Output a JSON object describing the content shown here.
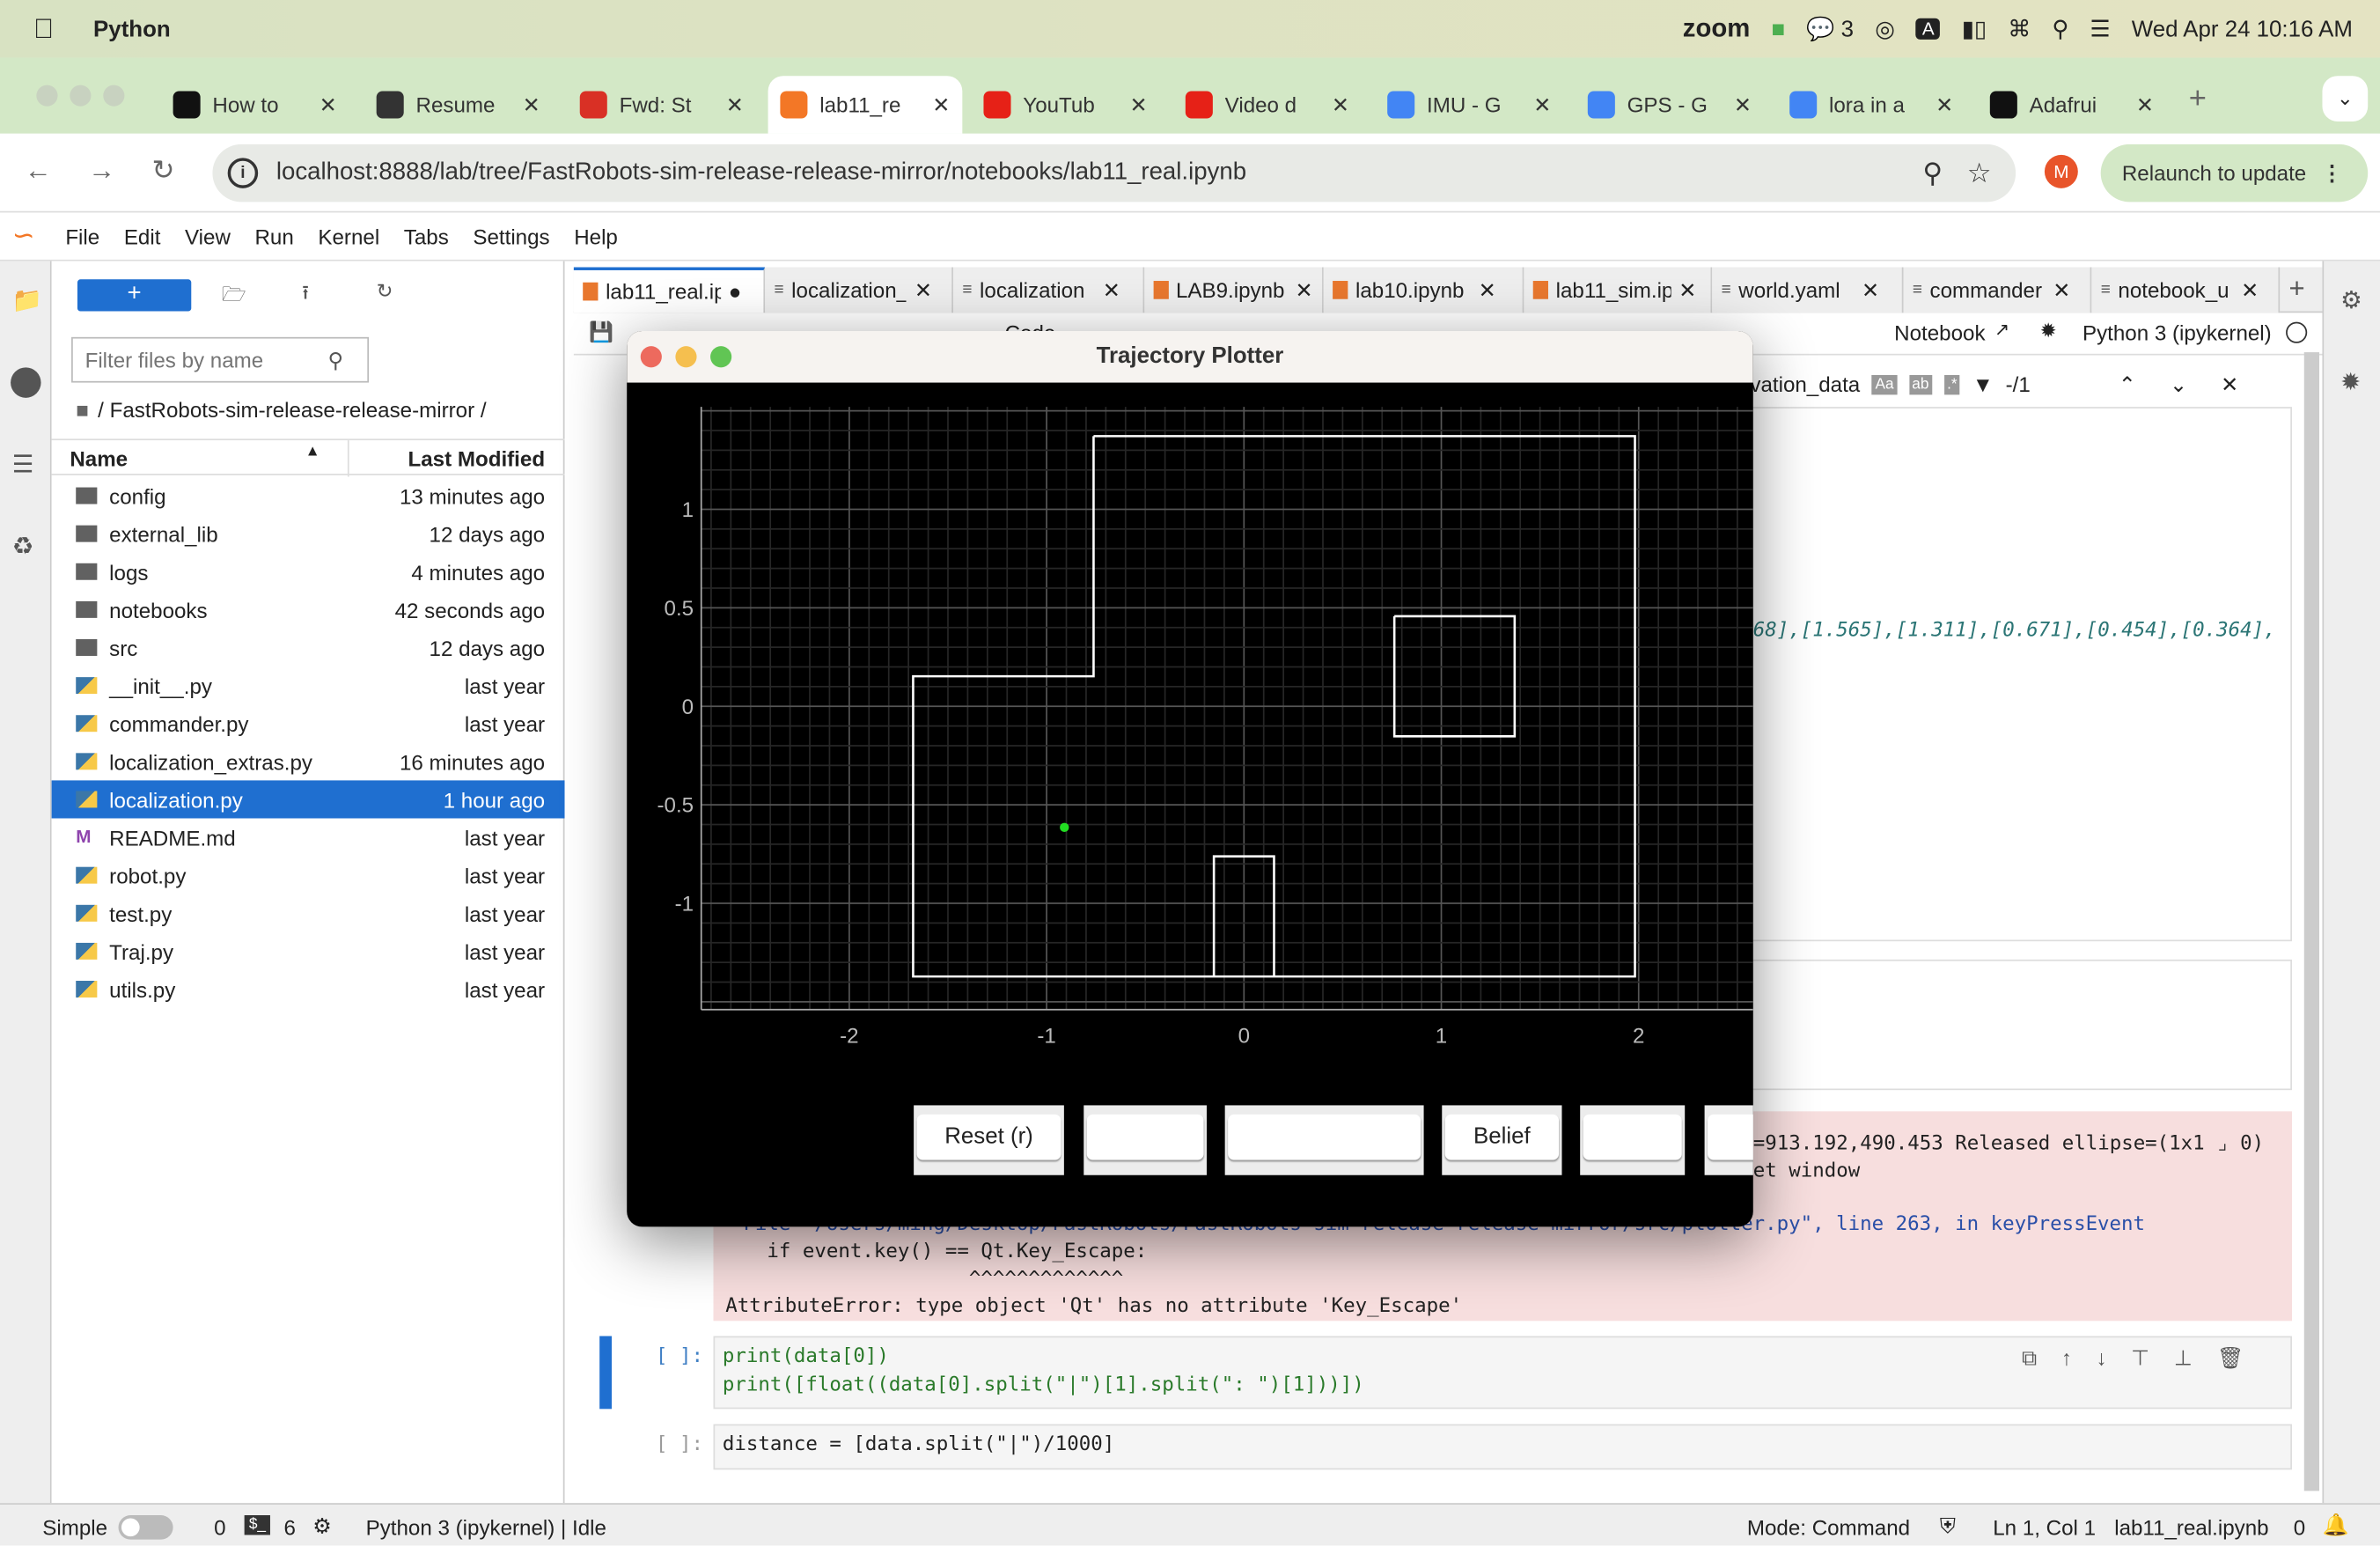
{
  "macos_menubar": {
    "app_name": "Python",
    "zoom": "zoom",
    "wechat_count": "3",
    "keyboard": "A",
    "datetime": "Wed Apr 24  10:16 AM"
  },
  "browser": {
    "tabs": [
      {
        "label": "How to",
        "icon": "bolt-icon",
        "color": "#111111"
      },
      {
        "label": "Resume",
        "icon": "globe-icon",
        "color": "#333333"
      },
      {
        "label": "Fwd: St",
        "icon": "gmail-icon",
        "color": "#d93025"
      },
      {
        "label": "lab11_re",
        "icon": "jupyter-icon",
        "color": "#f37726",
        "active": true
      },
      {
        "label": "YouTub",
        "icon": "youtube-icon",
        "color": "#e62117"
      },
      {
        "label": "Video d",
        "icon": "youtube-icon",
        "color": "#e62117"
      },
      {
        "label": "IMU - G",
        "icon": "google-icon",
        "color": "#4285f4"
      },
      {
        "label": "GPS - G",
        "icon": "google-icon",
        "color": "#4285f4"
      },
      {
        "label": "lora in a",
        "icon": "google-icon",
        "color": "#4285f4"
      },
      {
        "label": "Adafrui",
        "icon": "adafruit-icon",
        "color": "#111111"
      }
    ],
    "url": "localhost:8888/lab/tree/FastRobots-sim-release-release-mirror/notebooks/lab11_real.ipynb",
    "profile_initial": "M",
    "relaunch": "Relaunch to update"
  },
  "jupyter": {
    "menu": [
      "File",
      "Edit",
      "View",
      "Run",
      "Kernel",
      "Tabs",
      "Settings",
      "Help"
    ],
    "filter_placeholder": "Filter files by name",
    "breadcrumb": "/ FastRobots-sim-release-release-mirror /",
    "col_name": "Name",
    "col_modified": "Last Modified",
    "files": [
      {
        "name": "config",
        "modified": "13 minutes ago",
        "type": "folder"
      },
      {
        "name": "external_lib",
        "modified": "12 days ago",
        "type": "folder"
      },
      {
        "name": "logs",
        "modified": "4 minutes ago",
        "type": "folder"
      },
      {
        "name": "notebooks",
        "modified": "42 seconds ago",
        "type": "folder"
      },
      {
        "name": "src",
        "modified": "12 days ago",
        "type": "folder"
      },
      {
        "name": "__init__.py",
        "modified": "last year",
        "type": "python"
      },
      {
        "name": "commander.py",
        "modified": "last year",
        "type": "python"
      },
      {
        "name": "localization_extras.py",
        "modified": "16 minutes ago",
        "type": "python"
      },
      {
        "name": "localization.py",
        "modified": "1 hour ago",
        "type": "python",
        "selected": true
      },
      {
        "name": "README.md",
        "modified": "last year",
        "type": "markdown"
      },
      {
        "name": "robot.py",
        "modified": "last year",
        "type": "python"
      },
      {
        "name": "test.py",
        "modified": "last year",
        "type": "python"
      },
      {
        "name": "Traj.py",
        "modified": "last year",
        "type": "python"
      },
      {
        "name": "utils.py",
        "modified": "last year",
        "type": "python"
      }
    ],
    "nb_tabs": [
      {
        "label": "lab11_real.ip",
        "type": "notebook",
        "active": true
      },
      {
        "label": "localization_",
        "type": "text"
      },
      {
        "label": "localization",
        "type": "text"
      },
      {
        "label": "LAB9.ipynb",
        "type": "notebook"
      },
      {
        "label": "lab10.ipynb",
        "type": "notebook"
      },
      {
        "label": "lab11_sim.ip",
        "type": "notebook"
      },
      {
        "label": "world.yaml",
        "type": "text"
      },
      {
        "label": "commander",
        "type": "text"
      },
      {
        "label": "notebook_u",
        "type": "text"
      }
    ],
    "toolbar": {
      "cell_type": "Code",
      "notebook": "Notebook",
      "kernel": "Python 3 (ipykernel)"
    },
    "find": {
      "query": "observation_data",
      "count": "-/1"
    },
    "output_line": "68],[1.565],[1.311],[0.671],[0.454],[0.364],",
    "log_line1": "=913.192,490.453 Released ellipse=(1x1 ⌟ 0)",
    "log_line2": "et window",
    "trace_file": "  File \"/Users/ming/Desktop/FastRobots/FastRobots-sim-release-release-mirror/src/plotter.py\", line 263, in keyPressEvent",
    "trace_code": "    if event.key() == Qt.Key_Escape:",
    "trace_caret": "                     ^^^^^^^^^^^^^",
    "trace_error": "AttributeError: type object 'Qt' has no attribute 'Key_Escape'",
    "cells": [
      {
        "prompt": "[ ]:",
        "lines": [
          "print(data[0])",
          "print([float((data[0].split(\"|\")[1].split(\": \")[1]))])"
        ]
      },
      {
        "prompt": "[ ]:",
        "lines": [
          "distance = [data.split(\"|\")/1000]"
        ]
      }
    ],
    "status": {
      "mode_label": "Simple",
      "terminals": "0",
      "kernels": "6",
      "kernel_status": "Python 3 (ipykernel) | Idle",
      "mode": "Mode: Command",
      "position": "Ln 1, Col 1",
      "file": "lab11_real.ipynb",
      "notifications": "0"
    }
  },
  "plotter": {
    "title": "Trajectory Plotter",
    "buttons": [
      "Reset (r)",
      "",
      "",
      "Belief",
      "",
      ""
    ]
  },
  "chart_data": {
    "type": "line",
    "xlim": [
      -2.75,
      2.58
    ],
    "ylim": [
      -1.54,
      1.52
    ],
    "x_ticks": [
      "-2",
      "-1",
      "0",
      "1",
      "2"
    ],
    "x_tick_values": [
      -2,
      -1,
      0,
      1,
      2
    ],
    "y_ticks": [
      "1",
      "0.5",
      "0",
      "-0.5",
      "-1"
    ],
    "y_tick_values": [
      1,
      0.5,
      0,
      -0.5,
      -1
    ],
    "grid": true,
    "background": "#000000",
    "wall_color": "#ffffff",
    "point_color": "#22dd22",
    "walls": [
      [
        [
          -0.762,
          1.3716
        ],
        [
          1.9812,
          1.3716
        ],
        [
          1.9812,
          -1.3716
        ],
        [
          -1.6764,
          -1.3716
        ],
        [
          -1.6764,
          0.1524
        ],
        [
          -0.762,
          0.1524
        ],
        [
          -0.762,
          1.3716
        ]
      ],
      [
        [
          0.762,
          0.4572
        ],
        [
          1.3716,
          0.4572
        ],
        [
          1.3716,
          -0.1524
        ],
        [
          0.762,
          -0.1524
        ],
        [
          0.762,
          0.4572
        ]
      ],
      [
        [
          -0.1524,
          -1.3716
        ],
        [
          -0.1524,
          -0.762
        ],
        [
          0.1524,
          -0.762
        ],
        [
          0.1524,
          -1.3716
        ]
      ]
    ],
    "points": [
      [
        -0.91,
        -0.615
      ]
    ]
  }
}
